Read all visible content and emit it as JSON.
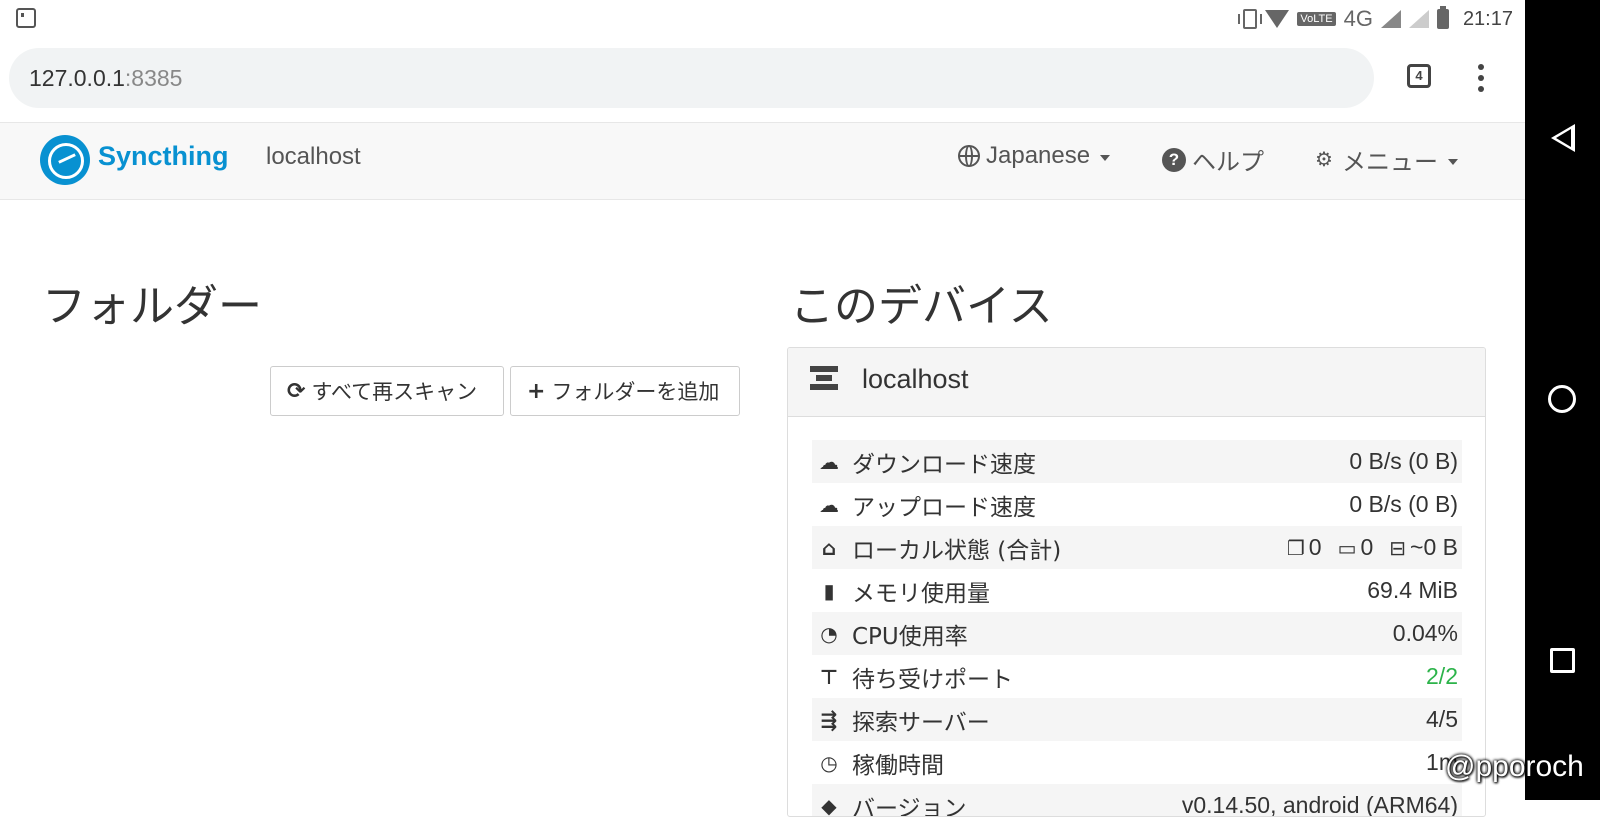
{
  "status_bar": {
    "network": "4G",
    "volte": "VoLTE",
    "time": "21:17"
  },
  "browser": {
    "url_host": "127.0.0.1",
    "url_port": ":8385",
    "tab_count": "4"
  },
  "navbar": {
    "brand": "Syncthing",
    "hostname": "localhost",
    "language": "Japanese",
    "help": "ヘルプ",
    "menu": "メニュー"
  },
  "folders": {
    "heading": "フォルダー",
    "rescan_label": "すべて再スキャン",
    "add_label": "フォルダーを追加"
  },
  "device": {
    "heading": "このデバイス",
    "name": "localhost",
    "rows": [
      {
        "label": "ダウンロード速度",
        "value": "0 B/s (0 B)",
        "icon": "cloud-download-icon"
      },
      {
        "label": "アップロード速度",
        "value": "0 B/s (0 B)",
        "icon": "cloud-upload-icon"
      },
      {
        "label": "ローカル状態 (合計)",
        "files": "0",
        "dirs": "0",
        "size": "~0 B",
        "icon": "home-icon"
      },
      {
        "label": "メモリ使用量",
        "value": "69.4 MiB",
        "icon": "memory-icon"
      },
      {
        "label": "CPU使用率",
        "value": "0.04%",
        "icon": "dashboard-icon"
      },
      {
        "label": "待ち受けポート",
        "value": "2/2",
        "icon": "sitemap-icon",
        "value_color": "#2cb34a"
      },
      {
        "label": "探索サーバー",
        "value": "4/5",
        "icon": "signpost-icon"
      },
      {
        "label": "稼働時間",
        "value": "1m",
        "icon": "clock-icon"
      },
      {
        "label": "バージョン",
        "value": "v0.14.50, android (ARM64)",
        "icon": "tag-icon"
      }
    ]
  },
  "watermark": "@pporoch",
  "colors": {
    "brand": "#0891d1",
    "navbar_bg": "#f8f8f8",
    "success": "#2cb34a"
  }
}
